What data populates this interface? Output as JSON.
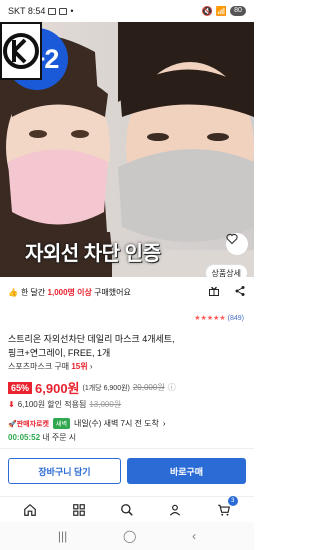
{
  "status_bar": {
    "carrier_time": "SKT 8:54",
    "battery": "80"
  },
  "hero": {
    "promo_badge": "2+2",
    "overlay_text": "자외선 차단 인증",
    "detail_button": "상품상세"
  },
  "purchase_note": {
    "prefix": "한 달간",
    "highlight": "1,000명 이상",
    "suffix": "구매했어요"
  },
  "rating": {
    "stars": "★★★★★",
    "count": "(849)"
  },
  "product": {
    "title_line1": "스트리온 자외선차단 데일리 마스크 4개세트,",
    "title_line2": "핑크+연그레이, FREE, 1개"
  },
  "seller": {
    "name": "스포츠마스크 구매",
    "rank": "15위"
  },
  "price": {
    "discount": "65%",
    "current": "6,900원",
    "unit_price": "(1개당 6,900원)",
    "original": "20,000원"
  },
  "coupon": {
    "arrow": "⬇",
    "text": "6,100원 할인 적용됨",
    "strike": "13,000원"
  },
  "delivery": {
    "rocket": "🚀판매자로켓",
    "new_tag": "새벽",
    "date": "내일(수) 새벽 7시 전 도착",
    "chevron": "›",
    "cutoff_time": "00:05:52",
    "cutoff_suffix": "내 주문 시"
  },
  "actions": {
    "cart_label": "장바구니 담기",
    "buy_label": "바로구매"
  },
  "bottom_nav": {
    "cart_count": "3"
  },
  "colors": {
    "accent": "#2a6bd6",
    "sale": "#e8232f",
    "green": "#2fa84f"
  }
}
